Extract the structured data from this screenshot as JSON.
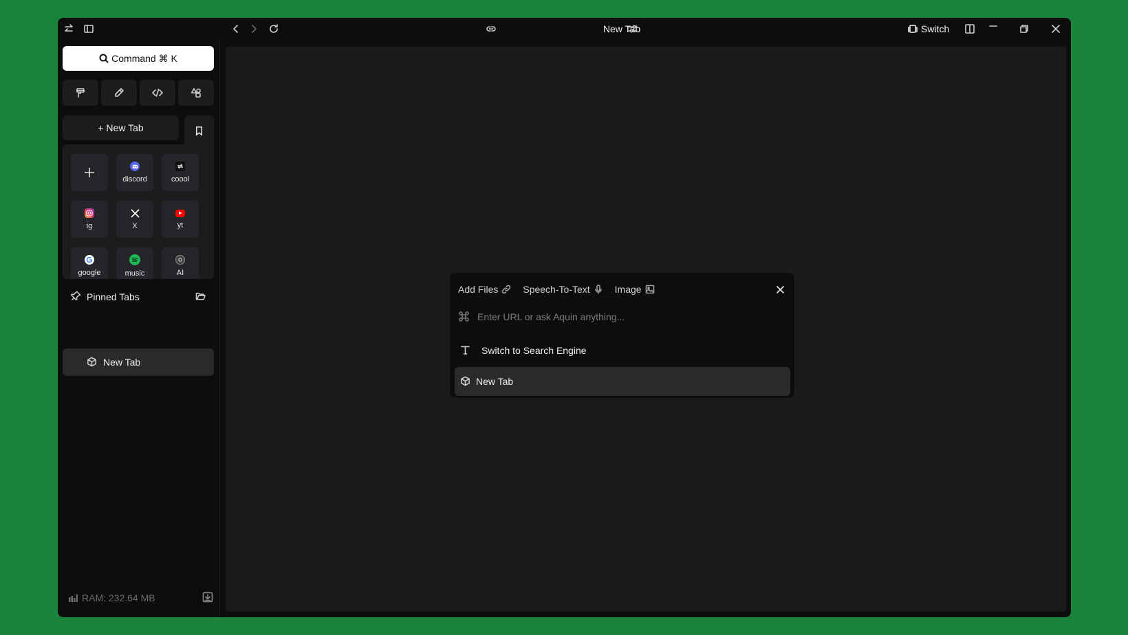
{
  "titlebar": {
    "title": "New Tab",
    "switch_label": "Switch"
  },
  "sidebar": {
    "command_label": "Command ⌘ K",
    "new_tab_label": "+ New Tab",
    "shortcuts": [
      {
        "label": "",
        "icon": "plus-icon"
      },
      {
        "label": "discord",
        "icon": "discord-icon",
        "color": "#5865F2"
      },
      {
        "label": "coool",
        "icon": "coool-icon",
        "color": "#111111"
      },
      {
        "label": "ig",
        "icon": "instagram-icon",
        "color": "#E1306C"
      },
      {
        "label": "X",
        "icon": "x-icon",
        "color": "#000000"
      },
      {
        "label": "yt",
        "icon": "youtube-icon",
        "color": "#FF0000"
      },
      {
        "label": "google",
        "icon": "google-icon",
        "color": "#ffffff"
      },
      {
        "label": "music",
        "icon": "spotify-icon",
        "color": "#1DB954"
      },
      {
        "label": "AI",
        "icon": "ai-icon",
        "color": "#444444"
      }
    ],
    "pinned_label": "Pinned Tabs",
    "tabs": [
      {
        "label": "New Tab"
      }
    ],
    "ram_label": "RAM: 232.64 MB"
  },
  "palette": {
    "actions": [
      {
        "label": "Add Files",
        "icon": "link-icon"
      },
      {
        "label": "Speech-To-Text",
        "icon": "microphone-icon"
      },
      {
        "label": "Image",
        "icon": "image-icon"
      }
    ],
    "input_placeholder": "Enter URL or ask Aquin anything...",
    "input_value": "",
    "options": [
      {
        "label": "Switch to Search Engine",
        "icon": "text-t-icon"
      },
      {
        "label": "New Tab",
        "icon": "cube-icon"
      }
    ]
  },
  "colors": {
    "background": "#198339",
    "window": "#0d0d0e",
    "content": "#1a1a1c",
    "selected": "#2a2a2d"
  }
}
